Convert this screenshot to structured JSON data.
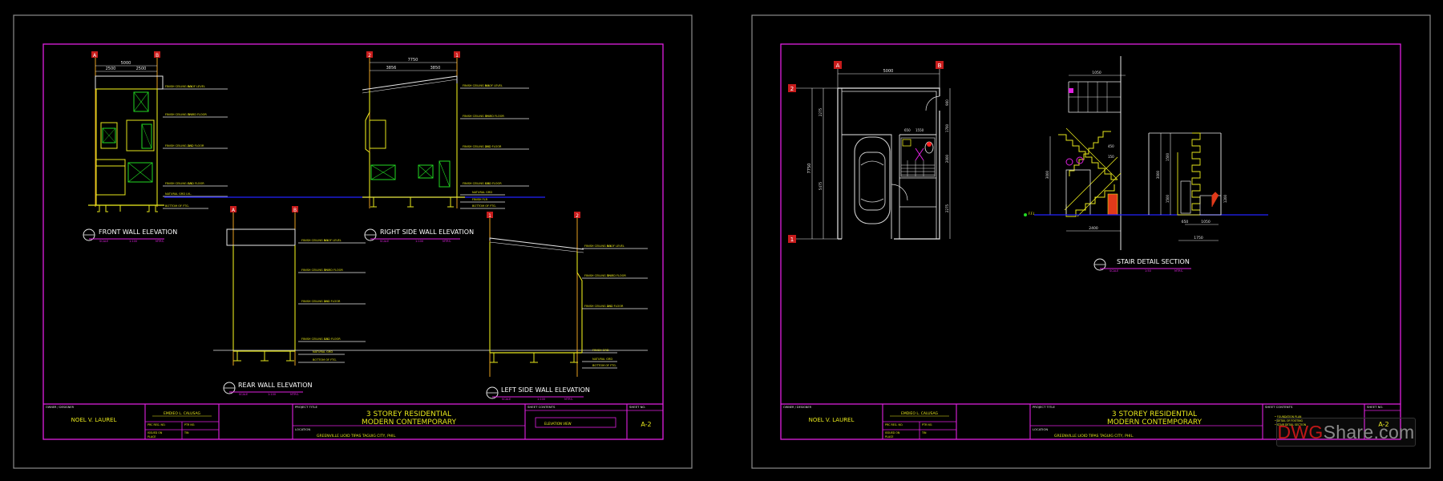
{
  "sheet1": {
    "titles": {
      "front": "FRONT WALL ELEVATION",
      "right": "RIGHT SIDE WALL ELEVATION",
      "rear": "REAR WALL ELEVATION",
      "left": "LEFT SIDE WALL ELEVATION"
    },
    "grid_labels": {
      "front_a": "A",
      "front_b": "B",
      "right_2": "2",
      "right_1": "1",
      "rear_a": "A",
      "rear_b": "B",
      "left_1": "1",
      "left_2": "2"
    },
    "dimensions": {
      "front_total": "5000",
      "front_left": "2500",
      "front_right": "2500",
      "right_total": "7750",
      "right_left": "3856",
      "right_right": "3850"
    }
  },
  "sheet2": {
    "titles": {
      "stair": "STAIR DETAIL SECTION"
    },
    "grid_labels": {
      "a": "A",
      "b": "B",
      "row_2": "2",
      "row_1": "1"
    },
    "dimensions": {
      "top": "5000",
      "side": "7750",
      "stair_top": "1050",
      "stair_bottom": "2400",
      "stair_bottom2": "1750",
      "stair_mid": "1050"
    }
  },
  "title_block": {
    "name": "NOEL V. LAUREL",
    "engineer": "EMDIEO L. CALUSAG",
    "project_line1": "3 STOREY RESIDENTIAL",
    "project_line2": "MODERN CONTEMPORARY",
    "project_title_label": "PROJECT TITLE",
    "location_label": "LOCATION",
    "location": "GREENVILLE LIOID TIPAS TAGUIG CITY, PHIL.",
    "sheet_contents_label": "SHEET CONTENTS",
    "sheet_no_label": "SHEET NO.",
    "sheet1_contents": "ELEVATION VIEW",
    "sheet_no": "A-2"
  },
  "watermark": {
    "brand_a": "DWG",
    "brand_b": "Share.com"
  },
  "colors": {
    "frame": "#e020e0",
    "line": "#e8e8e8",
    "yellow": "#e6e61c",
    "green": "#22d822",
    "blue": "#2020ff",
    "red": "#ff2020",
    "cyan": "#20e0e0"
  }
}
